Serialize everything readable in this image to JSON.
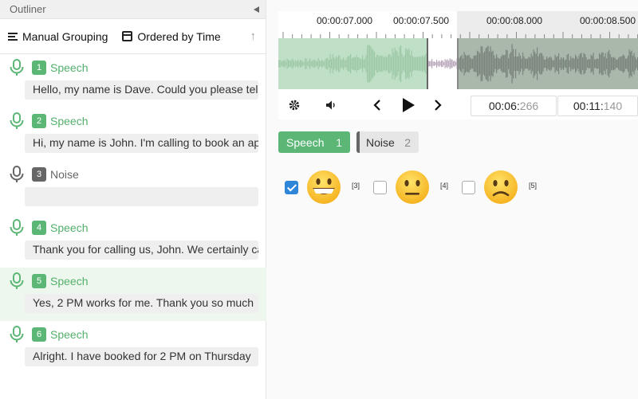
{
  "outliner": {
    "title": "Outliner",
    "grouping_label": "Manual Grouping",
    "ordering_label": "Ordered by Time",
    "regions": [
      {
        "index": "1",
        "label": "Speech",
        "text": "Hello, my name is Dave. Could you please tell me",
        "color": "green",
        "selected": false
      },
      {
        "index": "2",
        "label": "Speech",
        "text": "Hi, my name is John. I'm calling to book an appointment",
        "color": "green",
        "selected": false
      },
      {
        "index": "3",
        "label": "Noise",
        "text": "",
        "color": "gray",
        "selected": false
      },
      {
        "index": "4",
        "label": "Speech",
        "text": "Thank you for calling us, John. We certainly can",
        "color": "green",
        "selected": false
      },
      {
        "index": "5",
        "label": "Speech",
        "text": "Yes, 2 PM works for me. Thank you so much",
        "color": "green",
        "selected": true
      },
      {
        "index": "6",
        "label": "Speech",
        "text": "Alright. I have booked for 2 PM on Thursday",
        "color": "green",
        "selected": false
      }
    ]
  },
  "timeline": {
    "ticks": [
      "00:00:07.000",
      "00:00:07.500",
      "00:00:08.000",
      "00:00:08.500"
    ]
  },
  "player": {
    "current_time_main": "00:06:",
    "current_time_ms": "266",
    "total_time_main": "00:11:",
    "total_time_ms": "140"
  },
  "labels": [
    {
      "name": "Speech",
      "count": "1"
    },
    {
      "name": "Noise",
      "count": "2"
    }
  ],
  "sentiment": [
    {
      "key": "[3]",
      "checked": true,
      "face": "grin"
    },
    {
      "key": "[4]",
      "checked": false,
      "face": "neutral"
    },
    {
      "key": "[5]",
      "checked": false,
      "face": "sad"
    }
  ],
  "colors": {
    "speech": "#5cb777",
    "noise": "#666666",
    "accent_blue": "#2f86d8"
  }
}
